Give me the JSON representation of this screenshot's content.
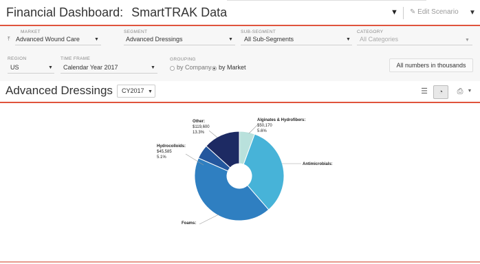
{
  "header": {
    "title": "Financial Dashboard:",
    "subtitle": "SmartTRAK Data",
    "edit_label": "Edit Scenario"
  },
  "filters": {
    "market": {
      "label": "MARKET",
      "value": "Advanced Wound Care"
    },
    "segment": {
      "label": "SEGMENT",
      "value": "Advanced Dressings"
    },
    "sub_segment": {
      "label": "SUB-SEGMENT",
      "value": "All Sub-Segments"
    },
    "category": {
      "label": "CATEGORY",
      "value": "All Categories"
    },
    "region": {
      "label": "REGION",
      "value": "US"
    },
    "time_frame": {
      "label": "TIME FRAME",
      "value": "Calendar Year 2017"
    },
    "grouping": {
      "label": "GROUPING",
      "options": [
        "by Company",
        "by Market"
      ],
      "selected": "by Market"
    },
    "numbers_note": "All numbers in thousands"
  },
  "section": {
    "title": "Advanced Dressings",
    "year": "CY2017"
  },
  "colors": {
    "accent": "#e0533c",
    "foams": "#2f7fc1",
    "antimicrobials": "#47b3d8",
    "alginates": "#b9e1dc",
    "other": "#1d2a63",
    "hydrocolloids": "#24579e"
  },
  "chart_data": {
    "type": "pie",
    "donut": true,
    "slices": [
      {
        "label": "Alginates & Hydrofibers:",
        "value_text": "$50,170",
        "percent_text": "5.6%",
        "percent": 5.6
      },
      {
        "label": "Antimicrobials:",
        "value_text": "",
        "percent_text": "",
        "percent": 33.0
      },
      {
        "label": "Foams:",
        "value_text": "",
        "percent_text": "",
        "percent": 43.0
      },
      {
        "label": "Hydrocolloids:",
        "value_text": "$45,585",
        "percent_text": "5.1%",
        "percent": 5.1
      },
      {
        "label": "Other:",
        "value_text": "$119,600",
        "percent_text": "13.3%",
        "percent": 13.3
      }
    ]
  }
}
